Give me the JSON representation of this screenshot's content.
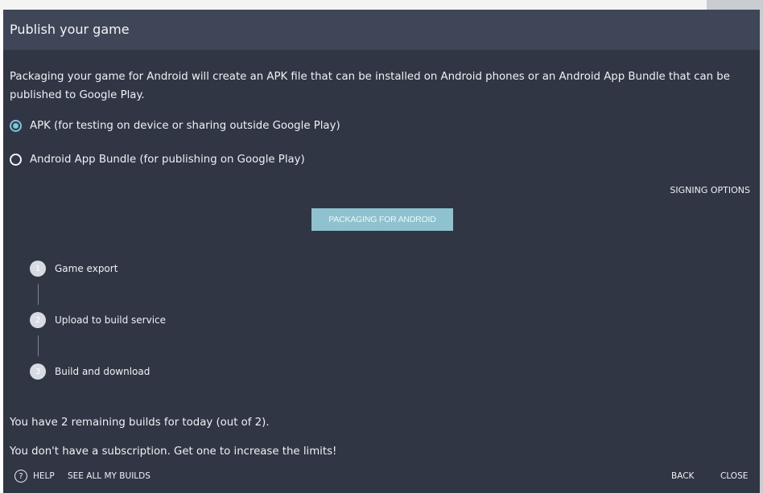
{
  "dialog": {
    "title": "Publish your game",
    "description": "Packaging your game for Android will create an APK file that can be installed on Android phones or an Android App Bundle that can be published to Google Play.",
    "options": [
      {
        "label": "APK (for testing on device or sharing outside Google Play)",
        "selected": true
      },
      {
        "label": "Android App Bundle (for publishing on Google Play)",
        "selected": false
      }
    ],
    "signing_options_label": "SIGNING OPTIONS",
    "package_button_label": "PACKAGING FOR ANDROID",
    "steps": [
      {
        "number": "1",
        "label": "Game export"
      },
      {
        "number": "2",
        "label": "Upload to build service"
      },
      {
        "number": "3",
        "label": "Build and download"
      }
    ],
    "remaining_builds_text": "You have 2 remaining builds for today (out of 2).",
    "subscription_text": "You don't have a subscription. Get one to increase the limits!"
  },
  "footer": {
    "help_icon_glyph": "?",
    "help_label": "HELP",
    "see_all_builds_label": "SEE ALL MY BUILDS",
    "back_label": "BACK",
    "close_label": "CLOSE"
  },
  "colors": {
    "dialog_background": "#303643",
    "title_bar": "#3f4658",
    "accent": "#7fc5dc",
    "button_background": "#8ec2cf",
    "text": "#eef1f5"
  }
}
